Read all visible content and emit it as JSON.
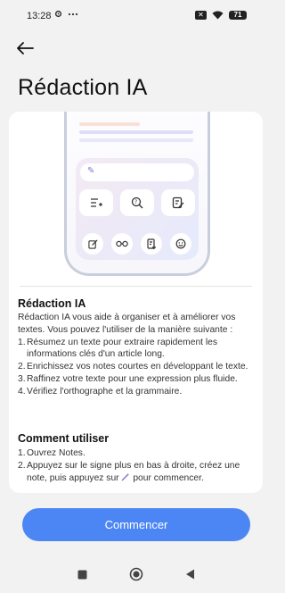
{
  "status_bar": {
    "time": "13:28",
    "battery": "71"
  },
  "header": {
    "title": "Rédaction IA"
  },
  "intro": {
    "title": "Rédaction IA",
    "description": "Rédaction IA vous aide à organiser et à améliorer vos textes. Vous pouvez l'utiliser de la manière suivante :",
    "items": [
      {
        "num": "1.",
        "text": "Résumez un texte pour extraire rapidement les informations clés d'un article long."
      },
      {
        "num": "2.",
        "text": "Enrichissez vos notes courtes en développant le texte."
      },
      {
        "num": "3.",
        "text": "Raffinez votre texte pour une expression plus fluide."
      },
      {
        "num": "4.",
        "text": "Vérifiez l'orthographe et la grammaire."
      }
    ]
  },
  "how_to": {
    "title": "Comment utiliser",
    "step1": {
      "num": "1.",
      "text": "Ouvrez Notes."
    },
    "step2": {
      "num": "2.",
      "before": "Appuyez sur le signe plus en bas à droite, créez une note, puis appuyez sur ",
      "after": " pour commencer."
    }
  },
  "start_button": {
    "label": "Commencer"
  },
  "colors": {
    "accent": "#4c86f4",
    "background": "#f2f2f2",
    "card": "#ffffff"
  },
  "icons": [
    "settings-icon",
    "more-icon",
    "sim-icon",
    "wifi-icon",
    "battery-icon",
    "back-arrow-icon",
    "ai-wand-icon",
    "list-add-icon",
    "search-question-icon",
    "edit-note-icon",
    "compose-icon",
    "glasses-icon",
    "doc-add-icon",
    "smiley-icon",
    "recents-icon",
    "home-icon",
    "back-icon"
  ]
}
